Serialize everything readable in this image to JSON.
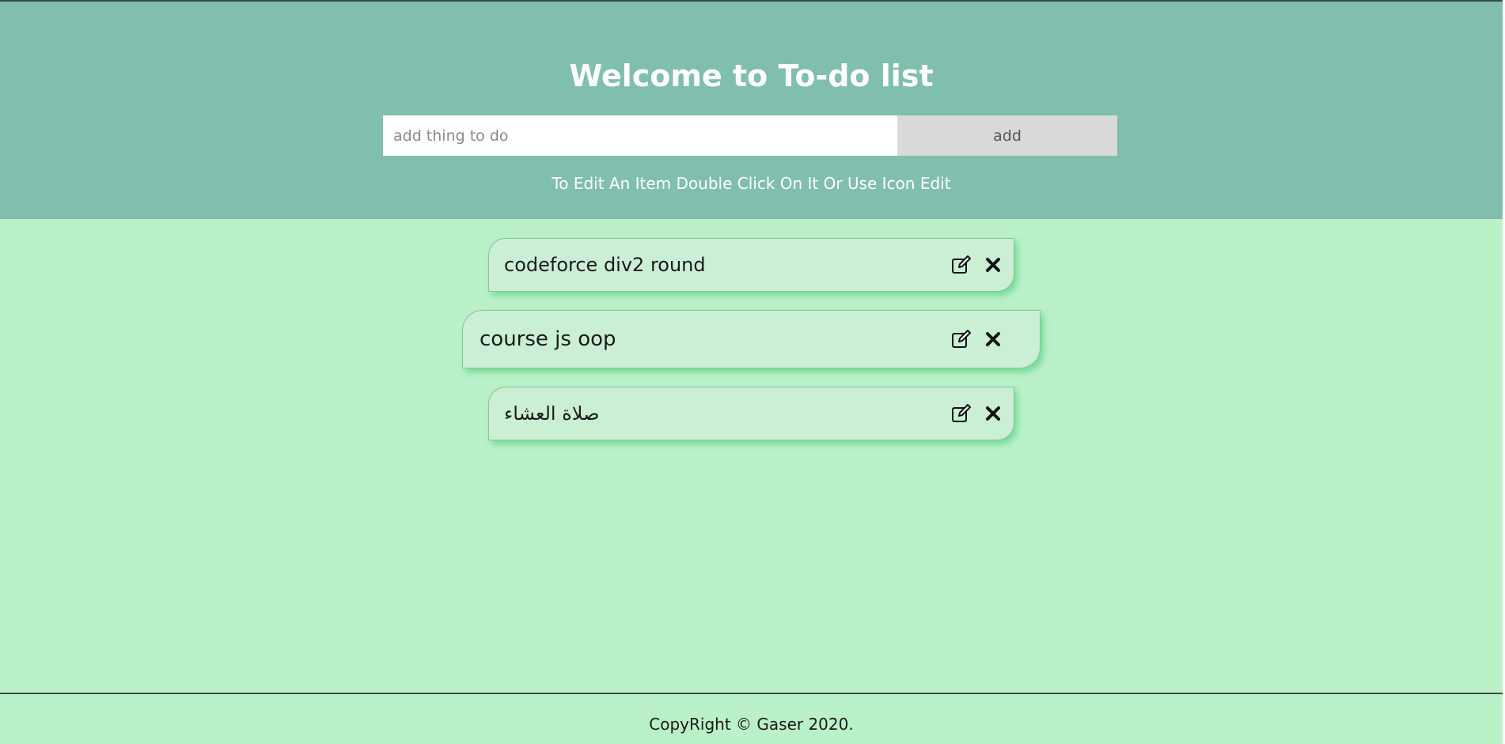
{
  "header": {
    "title": "Welcome to To-do list",
    "input_placeholder": "add thing to do",
    "input_value": "",
    "add_label": "add",
    "hint": "To Edit An Item Double Click On It Or Use Icon Edit"
  },
  "todos": [
    {
      "text": "codeforce div2 round",
      "edit_icon": "edit-icon",
      "delete_icon": "close-icon"
    },
    {
      "text": "course js oop",
      "edit_icon": "edit-icon",
      "delete_icon": "close-icon"
    },
    {
      "text": "صلاة العشاء",
      "edit_icon": "edit-icon",
      "delete_icon": "close-icon"
    }
  ],
  "footer": {
    "text": "CopyRight © Gaser 2020."
  },
  "colors": {
    "header_bg": "#80bfad",
    "page_bg": "#bbf1c9",
    "item_bg": "#cbefd5",
    "button_bg": "#d9d9d9"
  }
}
